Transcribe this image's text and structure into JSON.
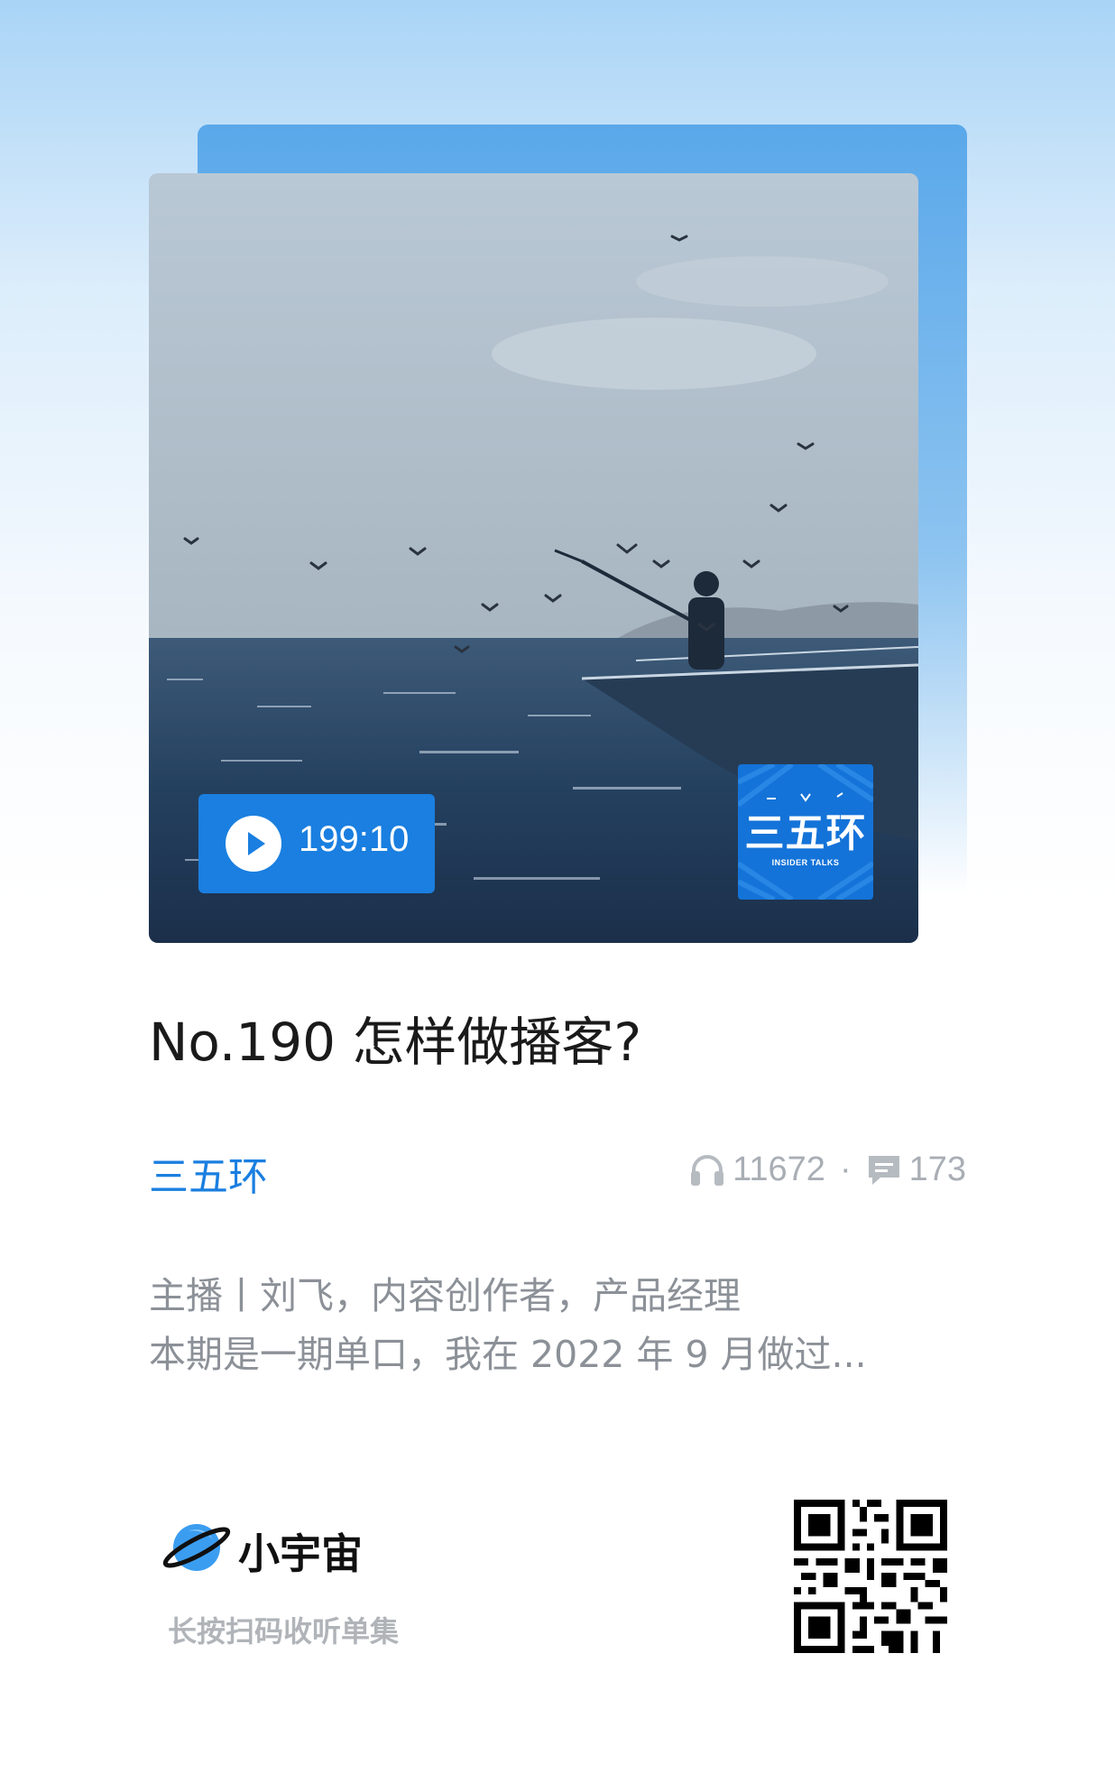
{
  "episode": {
    "duration": "199:10",
    "title": "No.190 怎样做播客?",
    "podcast_name": "三五环",
    "plays": "11672",
    "separator": "·",
    "comments": "173",
    "description": [
      "主播丨刘飞，内容创作者，产品经理",
      "本期是一期单口，我在 2022 年 9 月做过..."
    ]
  },
  "cover_logo": {
    "name": "三五环",
    "subtitle": "INSIDER TALKS"
  },
  "footer": {
    "brand": "小宇宙",
    "hint": "长按扫码收听单集"
  },
  "icons": {
    "play": "play-icon",
    "plays": "headphones-icon",
    "comments": "comment-icon",
    "brand": "planet-icon",
    "qr": "qr-code"
  },
  "colors": {
    "accent": "#1a7fe0",
    "title": "#1a1a1a",
    "muted": "#8c9198"
  }
}
